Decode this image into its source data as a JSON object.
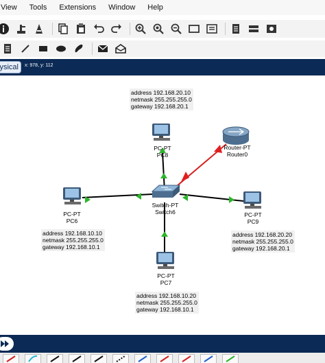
{
  "menu": {
    "items": [
      "View",
      "Tools",
      "Extensions",
      "Window",
      "Help"
    ]
  },
  "toolbar1": {
    "icons": [
      "information-icon",
      "network-wizard-icon",
      "activity-wizard-icon",
      "copy-icon",
      "paste-icon",
      "undo-icon",
      "redo-icon",
      "zoom-in-icon",
      "zoom-reset-icon",
      "zoom-out-icon",
      "drawing-palette-icon",
      "custom-devices-dialog-icon",
      "viewport-icon",
      "physical-view-icon",
      "screenshot-icon"
    ]
  },
  "toolbar2": {
    "icons": [
      "note-icon",
      "line-icon",
      "rectangle-icon",
      "ellipse-icon",
      "freeform-icon",
      "simple-pdu-icon",
      "complex-pdu-icon"
    ]
  },
  "mode": {
    "tab_label": "ysical",
    "coords": "x: 978, y: 112"
  },
  "devices": {
    "pc8": {
      "type": "PC-PT",
      "name": "PC8"
    },
    "router0": {
      "type": "Router-PT",
      "name": "Router0"
    },
    "pc6": {
      "type": "PC-PT",
      "name": "PC6"
    },
    "switch6": {
      "type": "Switch-PT",
      "name": "Switch6"
    },
    "pc9": {
      "type": "PC-PT",
      "name": "PC9"
    },
    "pc7": {
      "type": "PC-PT",
      "name": "PC7"
    }
  },
  "notes": {
    "pc8": {
      "address": "address 192.168.20.10",
      "netmask": "netmask 255.255.255.0",
      "gateway": "gateway 192.168.20.1"
    },
    "pc6": {
      "address": "address 192.168.10.10",
      "netmask": "netmask 255.255.255.0",
      "gateway": "gateway 192.168.10.1"
    },
    "pc9": {
      "address": "address 192.168.20.20",
      "netmask": "netmask 255.255.255.0",
      "gateway": "gateway 192.168.20.1"
    },
    "pc7": {
      "address": "address 192.168.10.20",
      "netmask": "netmask 255.255.255.0",
      "gateway": "gateway 192.168.10.1"
    }
  },
  "colors": {
    "link_up": "#2db52d",
    "link_down": "#e02020",
    "cable_straight": "#000000",
    "cable_console": "#d42020",
    "mode_bar": "#0b2a55"
  },
  "bottom": {
    "cables": [
      "cable-red",
      "cable-cyan",
      "cable-black",
      "cable-black",
      "cable-black",
      "cable-dashed",
      "cable-blue",
      "cable-red",
      "cable-red",
      "cable-blue",
      "cable-green"
    ]
  }
}
